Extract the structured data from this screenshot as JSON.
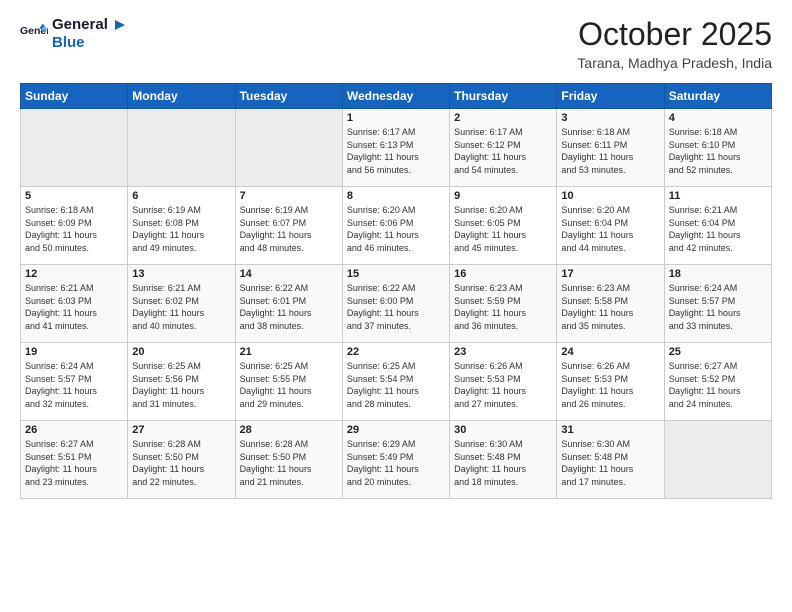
{
  "header": {
    "logo_line1": "General",
    "logo_line2": "Blue",
    "month": "October 2025",
    "location": "Tarana, Madhya Pradesh, India"
  },
  "weekdays": [
    "Sunday",
    "Monday",
    "Tuesday",
    "Wednesday",
    "Thursday",
    "Friday",
    "Saturday"
  ],
  "weeks": [
    [
      {
        "day": "",
        "info": ""
      },
      {
        "day": "",
        "info": ""
      },
      {
        "day": "",
        "info": ""
      },
      {
        "day": "1",
        "info": "Sunrise: 6:17 AM\nSunset: 6:13 PM\nDaylight: 11 hours\nand 56 minutes."
      },
      {
        "day": "2",
        "info": "Sunrise: 6:17 AM\nSunset: 6:12 PM\nDaylight: 11 hours\nand 54 minutes."
      },
      {
        "day": "3",
        "info": "Sunrise: 6:18 AM\nSunset: 6:11 PM\nDaylight: 11 hours\nand 53 minutes."
      },
      {
        "day": "4",
        "info": "Sunrise: 6:18 AM\nSunset: 6:10 PM\nDaylight: 11 hours\nand 52 minutes."
      }
    ],
    [
      {
        "day": "5",
        "info": "Sunrise: 6:18 AM\nSunset: 6:09 PM\nDaylight: 11 hours\nand 50 minutes."
      },
      {
        "day": "6",
        "info": "Sunrise: 6:19 AM\nSunset: 6:08 PM\nDaylight: 11 hours\nand 49 minutes."
      },
      {
        "day": "7",
        "info": "Sunrise: 6:19 AM\nSunset: 6:07 PM\nDaylight: 11 hours\nand 48 minutes."
      },
      {
        "day": "8",
        "info": "Sunrise: 6:20 AM\nSunset: 6:06 PM\nDaylight: 11 hours\nand 46 minutes."
      },
      {
        "day": "9",
        "info": "Sunrise: 6:20 AM\nSunset: 6:05 PM\nDaylight: 11 hours\nand 45 minutes."
      },
      {
        "day": "10",
        "info": "Sunrise: 6:20 AM\nSunset: 6:04 PM\nDaylight: 11 hours\nand 44 minutes."
      },
      {
        "day": "11",
        "info": "Sunrise: 6:21 AM\nSunset: 6:04 PM\nDaylight: 11 hours\nand 42 minutes."
      }
    ],
    [
      {
        "day": "12",
        "info": "Sunrise: 6:21 AM\nSunset: 6:03 PM\nDaylight: 11 hours\nand 41 minutes."
      },
      {
        "day": "13",
        "info": "Sunrise: 6:21 AM\nSunset: 6:02 PM\nDaylight: 11 hours\nand 40 minutes."
      },
      {
        "day": "14",
        "info": "Sunrise: 6:22 AM\nSunset: 6:01 PM\nDaylight: 11 hours\nand 38 minutes."
      },
      {
        "day": "15",
        "info": "Sunrise: 6:22 AM\nSunset: 6:00 PM\nDaylight: 11 hours\nand 37 minutes."
      },
      {
        "day": "16",
        "info": "Sunrise: 6:23 AM\nSunset: 5:59 PM\nDaylight: 11 hours\nand 36 minutes."
      },
      {
        "day": "17",
        "info": "Sunrise: 6:23 AM\nSunset: 5:58 PM\nDaylight: 11 hours\nand 35 minutes."
      },
      {
        "day": "18",
        "info": "Sunrise: 6:24 AM\nSunset: 5:57 PM\nDaylight: 11 hours\nand 33 minutes."
      }
    ],
    [
      {
        "day": "19",
        "info": "Sunrise: 6:24 AM\nSunset: 5:57 PM\nDaylight: 11 hours\nand 32 minutes."
      },
      {
        "day": "20",
        "info": "Sunrise: 6:25 AM\nSunset: 5:56 PM\nDaylight: 11 hours\nand 31 minutes."
      },
      {
        "day": "21",
        "info": "Sunrise: 6:25 AM\nSunset: 5:55 PM\nDaylight: 11 hours\nand 29 minutes."
      },
      {
        "day": "22",
        "info": "Sunrise: 6:25 AM\nSunset: 5:54 PM\nDaylight: 11 hours\nand 28 minutes."
      },
      {
        "day": "23",
        "info": "Sunrise: 6:26 AM\nSunset: 5:53 PM\nDaylight: 11 hours\nand 27 minutes."
      },
      {
        "day": "24",
        "info": "Sunrise: 6:26 AM\nSunset: 5:53 PM\nDaylight: 11 hours\nand 26 minutes."
      },
      {
        "day": "25",
        "info": "Sunrise: 6:27 AM\nSunset: 5:52 PM\nDaylight: 11 hours\nand 24 minutes."
      }
    ],
    [
      {
        "day": "26",
        "info": "Sunrise: 6:27 AM\nSunset: 5:51 PM\nDaylight: 11 hours\nand 23 minutes."
      },
      {
        "day": "27",
        "info": "Sunrise: 6:28 AM\nSunset: 5:50 PM\nDaylight: 11 hours\nand 22 minutes."
      },
      {
        "day": "28",
        "info": "Sunrise: 6:28 AM\nSunset: 5:50 PM\nDaylight: 11 hours\nand 21 minutes."
      },
      {
        "day": "29",
        "info": "Sunrise: 6:29 AM\nSunset: 5:49 PM\nDaylight: 11 hours\nand 20 minutes."
      },
      {
        "day": "30",
        "info": "Sunrise: 6:30 AM\nSunset: 5:48 PM\nDaylight: 11 hours\nand 18 minutes."
      },
      {
        "day": "31",
        "info": "Sunrise: 6:30 AM\nSunset: 5:48 PM\nDaylight: 11 hours\nand 17 minutes."
      },
      {
        "day": "",
        "info": ""
      }
    ]
  ]
}
